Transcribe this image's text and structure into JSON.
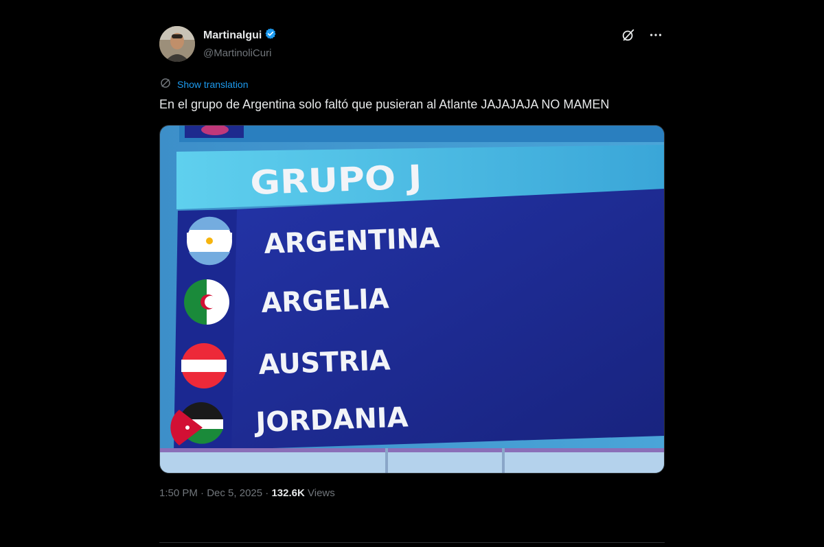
{
  "author": {
    "display_name": "Martinalgui",
    "handle": "@MartinoliCuri",
    "verified": true,
    "badge_color": "#1d9bf0"
  },
  "header_actions": {
    "grok_icon": "grok-icon",
    "more_icon": "more-icon"
  },
  "translate": {
    "label": "Show translation"
  },
  "tweet": {
    "text": "En el grupo de Argentina solo faltó que pusieran al Atlante JAJAJAJA NO MAMEN"
  },
  "media": {
    "group_title": "GRUPO J",
    "teams": [
      {
        "name": "ARGENTINA",
        "flag": "argentina-flag-icon"
      },
      {
        "name": "ARGELIA",
        "flag": "algeria-flag-icon"
      },
      {
        "name": "AUSTRIA",
        "flag": "austria-flag-icon"
      },
      {
        "name": "JORDANIA",
        "flag": "jordan-flag-icon"
      }
    ]
  },
  "meta": {
    "time": "1:50 PM",
    "separator": "·",
    "date": "Dec 5, 2025",
    "views_count": "132.6K",
    "views_label": "Views"
  },
  "colors": {
    "background": "#000000",
    "text_primary": "#e7e9ea",
    "text_secondary": "#71767b",
    "link": "#1d9bf0",
    "board_header": "#4ec3e6",
    "board_body": "#1f2c9a"
  }
}
